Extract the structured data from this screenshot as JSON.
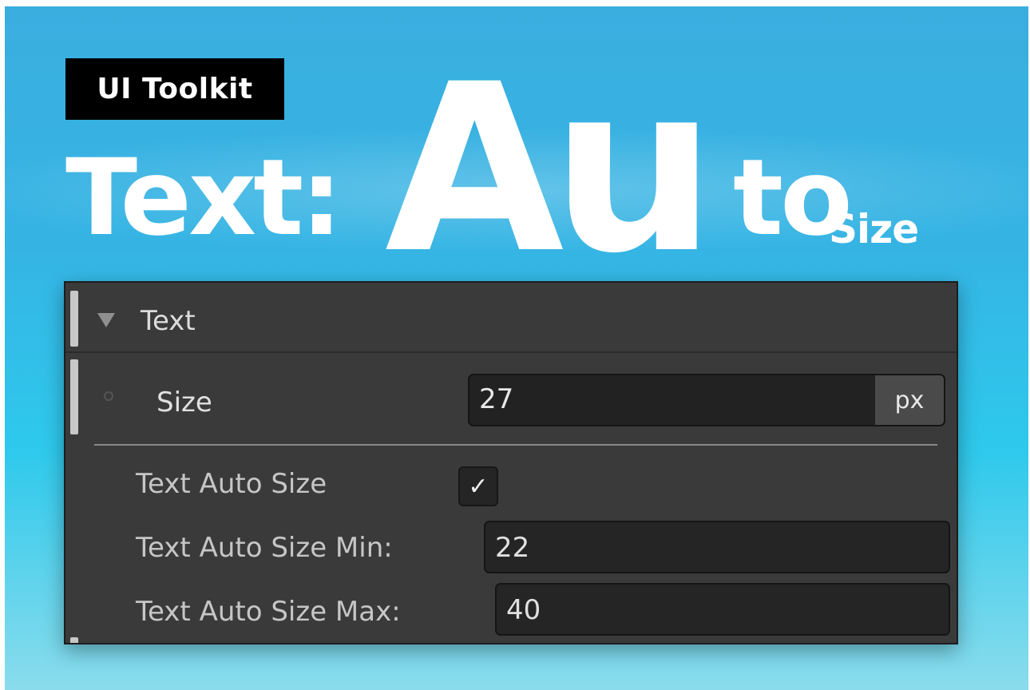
{
  "badge": {
    "label": "UI Toolkit"
  },
  "headline": {
    "prefix": "Text:",
    "big": "Au",
    "mid": "to",
    "small": "Size"
  },
  "panel": {
    "section_title": "Text",
    "size": {
      "label": "Size",
      "value": "27",
      "unit": "px"
    },
    "text_auto_size": {
      "label": "Text Auto Size",
      "checked": true,
      "check_glyph": "✓"
    },
    "text_auto_size_min": {
      "label": "Text Auto Size Min:",
      "value": "22"
    },
    "text_auto_size_max": {
      "label": "Text Auto Size Max:",
      "value": "40"
    }
  },
  "colors": {
    "background_top": "#3aaedf",
    "background_bottom": "#8adcec",
    "panel_bg": "#3a3a3a",
    "field_bg": "#222222",
    "headline": "#ffffff",
    "badge_bg": "#000000"
  },
  "icons": {
    "foldout": "triangle-down-icon",
    "override": "circle-icon",
    "check": "checkmark-icon"
  }
}
